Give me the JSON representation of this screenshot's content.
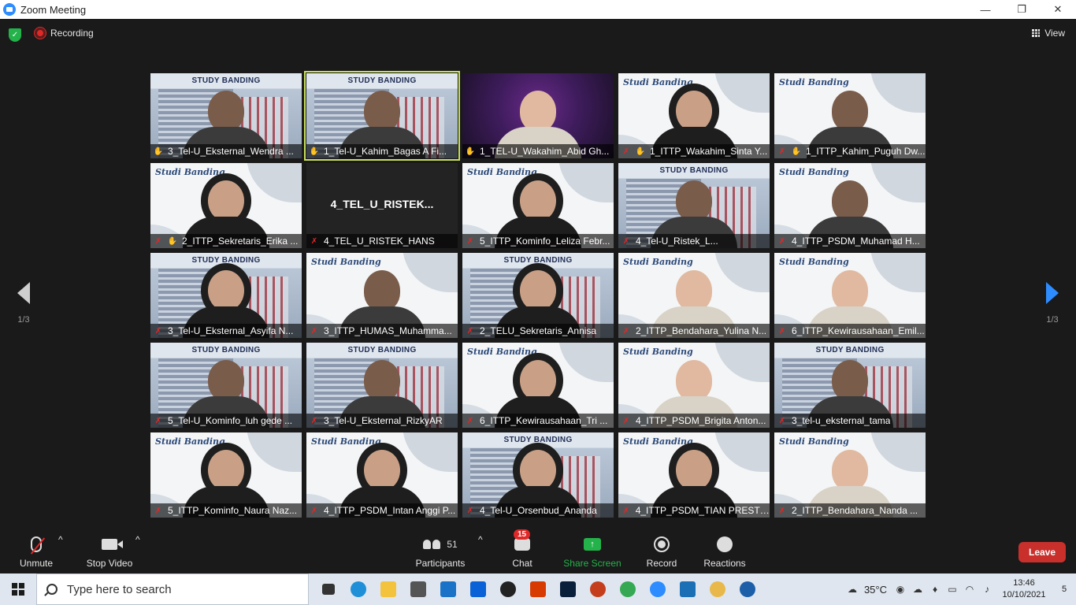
{
  "window": {
    "title": "Zoom Meeting",
    "minimize": "—",
    "maximize": "❐",
    "close": "✕"
  },
  "topbar": {
    "recording_label": "Recording",
    "view_label": "View"
  },
  "pager": {
    "left": "1/3",
    "right": "1/3"
  },
  "tiles": [
    {
      "name": "3_Tel-U_Eksternal_Wendra ...",
      "bg": "building",
      "icon": "hand",
      "person": "dark"
    },
    {
      "name": "1_Tel-U_Kahim_Bagas A Fi...",
      "bg": "building",
      "icon": "hand",
      "person": "dark",
      "active": true
    },
    {
      "name": "1_TEL-U_Wakahim_Abid Gh...",
      "bg": "purple",
      "icon": "hand",
      "person": "light"
    },
    {
      "name": "1_ITTP_Wakahim_Sinta Y...",
      "bg": "studi",
      "icon": "muted-hand",
      "person": "hijab"
    },
    {
      "name": "1_ITTP_Kahim_Puguh Dw...",
      "bg": "studi",
      "icon": "muted-hand",
      "person": "dark"
    },
    {
      "name": "2_ITTP_Sekretaris_Erika ...",
      "bg": "studi",
      "icon": "muted-hand",
      "person": "hijab"
    },
    {
      "name": "4_TEL_U_RISTEK_HANS",
      "bg": "blank",
      "icon": "muted",
      "bigname": "4_TEL_U_RISTEK..."
    },
    {
      "name": "5_ITTP_Kominfo_Leliza Febr...",
      "bg": "studi",
      "icon": "muted",
      "person": "hijab"
    },
    {
      "name": "4_Tel-U_Ristek_L...",
      "bg": "building",
      "icon": "muted",
      "person": "dark"
    },
    {
      "name": "4_ITTP_PSDM_Muhamad H...",
      "bg": "studi",
      "icon": "muted",
      "person": "dark"
    },
    {
      "name": "3_Tel-U_Eksternal_Asyifa N...",
      "bg": "building",
      "icon": "muted",
      "person": "hijab"
    },
    {
      "name": "3_ITTP_HUMAS_Muhamma...",
      "bg": "studi",
      "icon": "muted",
      "person": "dark"
    },
    {
      "name": "2_TELU_Sekretaris_Annisa",
      "bg": "building",
      "icon": "muted",
      "person": "hijab"
    },
    {
      "name": "2_ITTP_Bendahara_Yulina N...",
      "bg": "studi",
      "icon": "muted",
      "person": "light"
    },
    {
      "name": "6_ITTP_Kewirausahaan_Emil...",
      "bg": "studi",
      "icon": "muted",
      "person": "light"
    },
    {
      "name": "5_Tel-U_Kominfo_luh gede ...",
      "bg": "building",
      "icon": "muted",
      "person": "dark"
    },
    {
      "name": "3_Tel-U_Eksternal_RizkyAR",
      "bg": "building",
      "icon": "muted",
      "person": "dark"
    },
    {
      "name": "6_ITTP_Kewirausahaan_Tri ...",
      "bg": "studi",
      "icon": "muted",
      "person": "hijab"
    },
    {
      "name": "4_ITTP_PSDM_Brigita Anton...",
      "bg": "studi",
      "icon": "muted",
      "person": "light"
    },
    {
      "name": "3_tel-u_eksternal_tama",
      "bg": "building",
      "icon": "muted",
      "person": "dark"
    },
    {
      "name": "5_ITTP_Kominfo_Naura Naz...",
      "bg": "studi",
      "icon": "muted",
      "person": "hijab"
    },
    {
      "name": "4_ITTP_PSDM_Intan Anggi P...",
      "bg": "studi",
      "icon": "muted",
      "person": "hijab"
    },
    {
      "name": "4_Tel-U_Orsenbud_Ananda",
      "bg": "building",
      "icon": "muted",
      "person": "hijab"
    },
    {
      "name": "4_ITTP_PSDM_TIAN PRESTI ...",
      "bg": "studi",
      "icon": "muted",
      "person": "hijab"
    },
    {
      "name": "2_ITTP_Bendahara_Nanda ...",
      "bg": "studi",
      "icon": "muted",
      "person": "light"
    }
  ],
  "tile_bg_text": {
    "building_title": "STUDY BANDING",
    "studi_title": "Studi Banding"
  },
  "controls": {
    "unmute": "Unmute",
    "stop_video": "Stop Video",
    "participants": "Participants",
    "participants_count": "51",
    "chat": "Chat",
    "chat_badge": "15",
    "share_screen": "Share Screen",
    "record": "Record",
    "reactions": "Reactions",
    "leave": "Leave"
  },
  "taskbar": {
    "search_placeholder": "Type here to search",
    "temperature": "35°C",
    "time": "13:46",
    "date": "10/10/2021",
    "notifications": "5"
  },
  "colors": {
    "accent": "#2D8CFF",
    "muted": "#E02828",
    "share": "#23B34A",
    "leave": "#C9302C",
    "active_speaker": "#C8E05A"
  },
  "icons": [
    "shield-icon",
    "recording-icon",
    "view-grid-icon",
    "mic-muted-icon",
    "video-camera-icon",
    "participants-icon",
    "chat-icon",
    "share-screen-icon",
    "record-icon",
    "reactions-icon",
    "windows-logo-icon",
    "search-icon"
  ]
}
